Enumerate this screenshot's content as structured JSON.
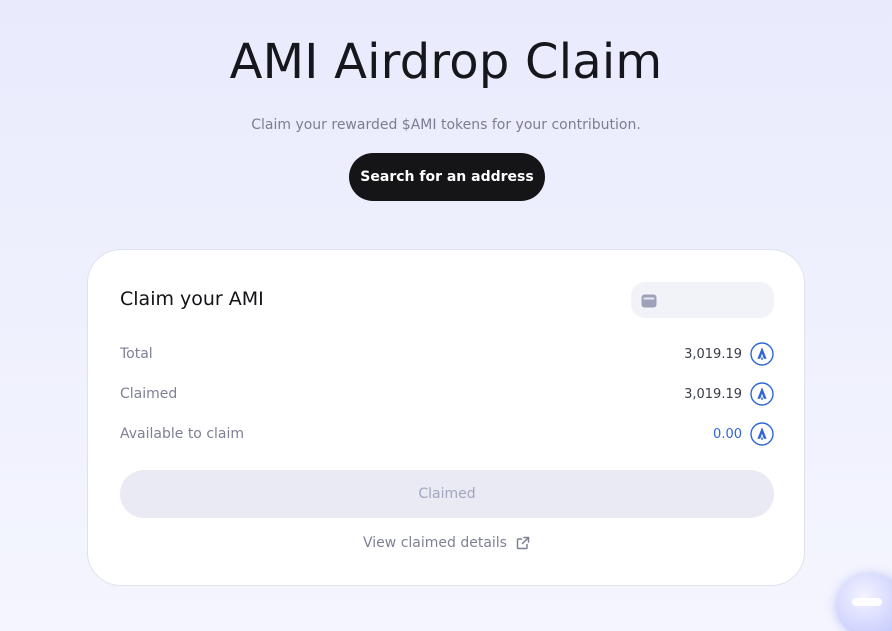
{
  "hero": {
    "title": "AMI Airdrop Claim",
    "subtitle": "Claim your rewarded $AMI tokens for your contribution.",
    "search_button_label": "Search for an address"
  },
  "card": {
    "title": "Claim your AMI",
    "wallet_chip_value": "",
    "wallet_icon": "wallet-icon",
    "rows": [
      {
        "label": "Total",
        "value": "3,019.19",
        "icon": "ami-token-icon"
      },
      {
        "label": "Claimed",
        "value": "3,019.19",
        "icon": "ami-token-icon"
      },
      {
        "label": "Available to claim",
        "value": "0.00",
        "icon": "ami-token-icon"
      }
    ],
    "claim_button_label": "Claimed",
    "details_link_label": "View claimed details",
    "details_link_icon": "external-link-icon"
  },
  "colors": {
    "accent": "#2f66d8",
    "primary_button": "#151517",
    "disabled_button": "#e9eaf3"
  },
  "floating_widget_icon": "chat-bubble-icon"
}
